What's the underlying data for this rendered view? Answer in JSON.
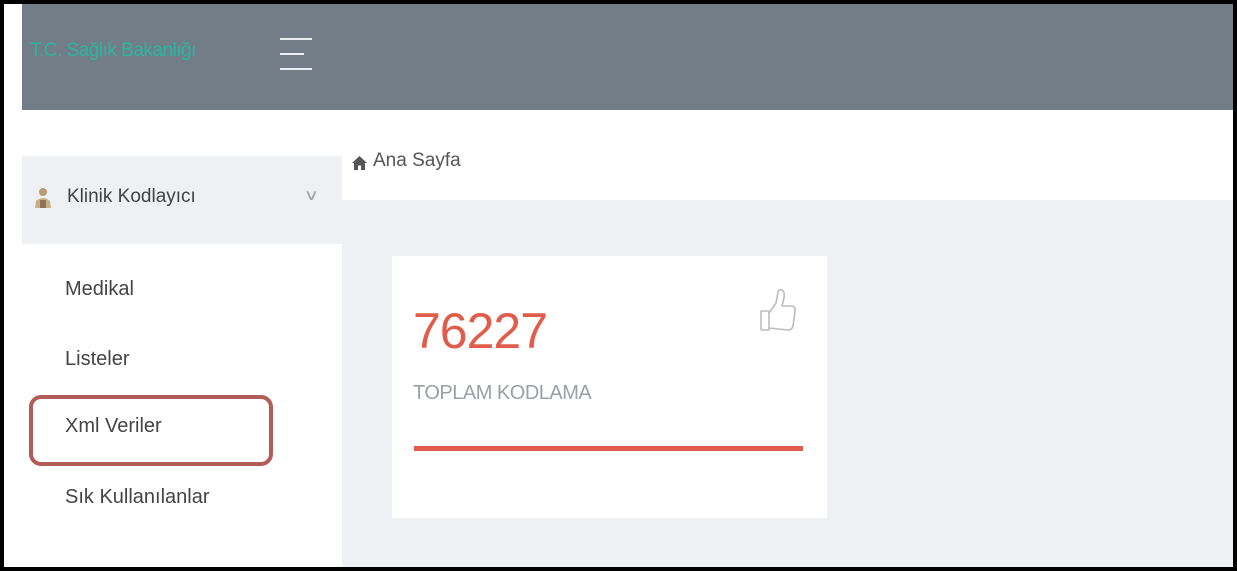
{
  "header": {
    "brand": "T.C. Sağlık Bakanlığı",
    "menu_icon": "hamburger-icon"
  },
  "sidebar": {
    "group": {
      "label": "Klinik Kodlayıcı",
      "icon": "user-icon",
      "chevron": "chevron-down-icon"
    },
    "items": [
      {
        "label": "Medikal"
      },
      {
        "label": "Listeler"
      },
      {
        "label": "Xml Veriler",
        "highlighted": true
      },
      {
        "label": "Sık Kullanılanlar"
      }
    ]
  },
  "breadcrumb": {
    "icon": "home-icon",
    "label": "Ana Sayfa"
  },
  "stat_card": {
    "value": "76227",
    "label": "TOPLAM KODLAMA",
    "icon": "thumbs-up-icon",
    "progress": 1.0
  },
  "colors": {
    "topbar": "#737d87",
    "brand": "#29b6a0",
    "accent": "#e25c4b",
    "highlight_border": "#b25c58"
  }
}
